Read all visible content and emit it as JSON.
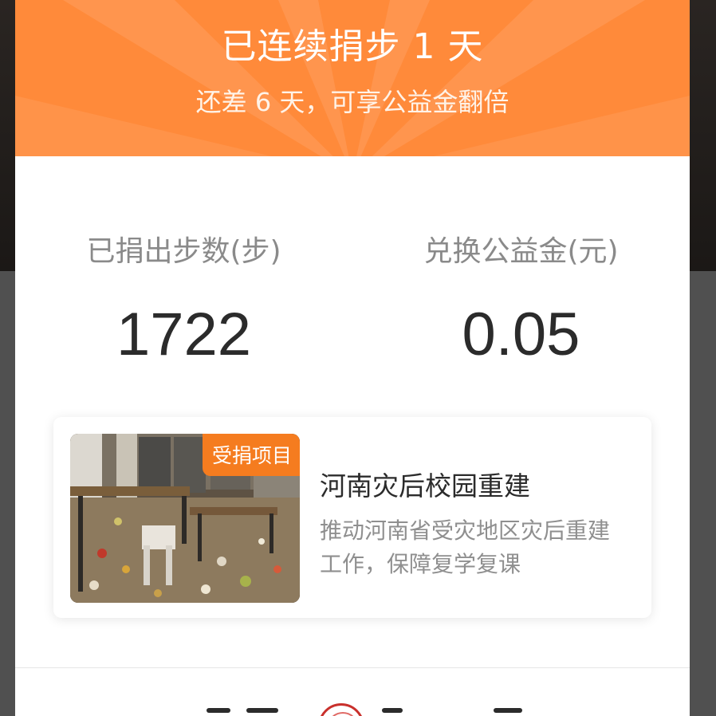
{
  "colors": {
    "header_orange": "#ff8a3a",
    "badge_orange": "#f57c1f",
    "card_white": "#ffffff",
    "label_gray": "#8a8a8a",
    "value_dark": "#2b2b2b"
  },
  "header": {
    "title": "已连续捐步 1 天",
    "subtitle": "还差 6 天，可享公益金翻倍"
  },
  "stats": {
    "donated_steps": {
      "label": "已捐出步数(步)",
      "value": "1722"
    },
    "exchanged_fund": {
      "label": "兑换公益金(元)",
      "value": "0.05"
    }
  },
  "project": {
    "badge": "受捐项目",
    "title": "河南灾后校园重建",
    "description": "推动河南省受灾地区灾后重建工作，保障复学复课",
    "thumbnail_icon": "flood-damaged-classroom-photo"
  }
}
